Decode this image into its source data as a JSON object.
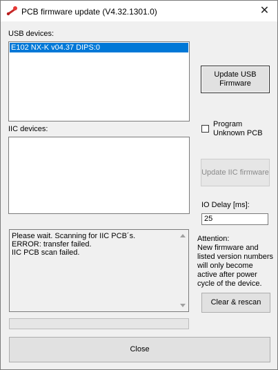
{
  "window": {
    "title": "PCB firmware update (V4.32.1301.0)",
    "close_glyph": "✕"
  },
  "usb": {
    "label": "USB devices:",
    "items": [
      "E102 NX-K v04.37 DIPS:0"
    ]
  },
  "iic": {
    "label": "IIC devices:",
    "items": []
  },
  "buttons": {
    "update_usb": "Update USB Firmware",
    "update_iic": "Update IIC firmware",
    "clear_rescan": "Clear & rescan",
    "close": "Close"
  },
  "program_unknown": {
    "label": "Program Unknown PCB",
    "checked": false
  },
  "io_delay": {
    "label": "IO Delay [ms]:",
    "value": "25"
  },
  "log": {
    "lines": [
      "Please wait. Scanning for IIC PCB´s.",
      "ERROR: transfer failed.",
      "IIC PCB scan failed."
    ]
  },
  "attention": {
    "text": "Attention:\nNew firmware and listed version numbers will only become active after power cycle of the device."
  },
  "colors": {
    "selection": "#0078d7",
    "window_bg": "#f0f0f0"
  }
}
